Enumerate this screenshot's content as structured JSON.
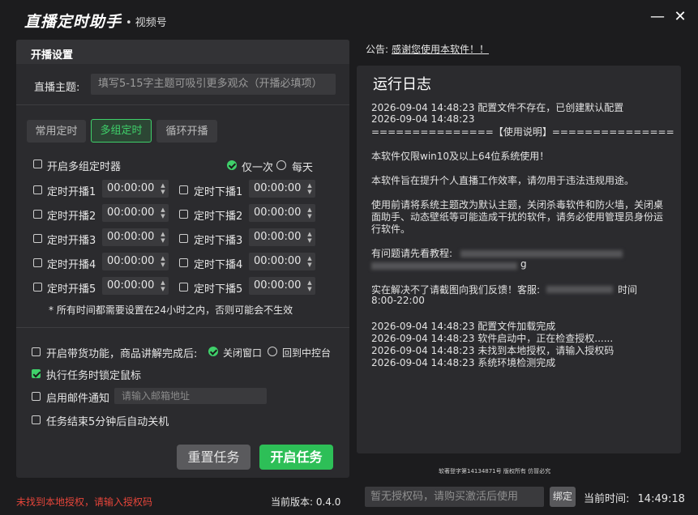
{
  "app": {
    "title": "直播定时助手",
    "subtitle": "• 视频号",
    "minimize_glyph": "—",
    "close_glyph": "✕"
  },
  "settings": {
    "header": "开播设置",
    "topic_label": "直播主题:",
    "topic_placeholder": "填写5-15字主题可吸引更多观众（开播必填项）",
    "tabs": [
      {
        "label": "常用定时",
        "active": false
      },
      {
        "label": "多组定时",
        "active": true
      },
      {
        "label": "循环开播",
        "active": false
      }
    ],
    "multi_timer_label": "开启多组定时器",
    "mode_once": "仅一次",
    "mode_daily": "每天",
    "timers": [
      {
        "start_label": "定时开播1",
        "start_time": "00:00:00",
        "stop_label": "定时下播1",
        "stop_time": "00:00:00"
      },
      {
        "start_label": "定时开播2",
        "start_time": "00:00:00",
        "stop_label": "定时下播2",
        "stop_time": "00:00:00"
      },
      {
        "start_label": "定时开播3",
        "start_time": "00:00:00",
        "stop_label": "定时下播3",
        "stop_time": "00:00:00"
      },
      {
        "start_label": "定时开播4",
        "start_time": "00:00:00",
        "stop_label": "定时下播4",
        "stop_time": "00:00:00"
      },
      {
        "start_label": "定时开播5",
        "start_time": "00:00:00",
        "stop_label": "定时下播5",
        "stop_time": "00:00:00"
      }
    ],
    "time_note": "* 所有时间都需要设置在24小时之内，否则可能会不生效",
    "goods_label": "开启带货功能，商品讲解完成后:",
    "close_window": "关闭窗口",
    "back_console": "回到中控台",
    "lock_mouse_label": "执行任务时锁定鼠标",
    "email_label": "启用邮件通知",
    "email_placeholder": "请输入邮箱地址",
    "shutdown_label": "任务结束5分钟后自动关机",
    "reset_button": "重置任务",
    "start_button": "开启任务"
  },
  "notice": {
    "prefix": "公告:",
    "text": "感谢您使用本软件！！"
  },
  "log": {
    "title": "运行日志",
    "lines": [
      "2026-09-04 14:48:23 配置文件不存在，已创建默认配置",
      "2026-09-04 14:48:23",
      "===============【使用说明】===============",
      "本软件仅限win10及以上64位系统使用！",
      "本软件旨在提升个人直播工作效率，请勿用于违法违规用途。",
      "使用前请将系统主题改为默认主题，关闭杀毒软件和防火墙，关闭桌",
      "面助手、动态壁纸等可能造成干扰的软件，请务必使用管理员身份运",
      "行软件。",
      "有问题请先看教程:",
      "g",
      "实在解决不了请截图向我们反馈！客服:",
      "时间",
      "8:00-22:00",
      "2026-09-04 14:48:23 配置文件加载完成",
      "2026-09-04 14:48:23 软件启动中，正在检查授权......",
      "2026-09-04 14:48:23 未找到本地授权，请输入授权码",
      "2026-09-04 14:48:23 系统环境检测完成"
    ]
  },
  "copyright": "软著登字第14134871号 版权所有 仿冒必究",
  "footer": {
    "license_warning": "未找到本地授权，请输入授权码",
    "version_label": "当前版本: 0.4.0",
    "code_placeholder": "暂无授权码，请购买激活后使用",
    "bind_button": "绑定",
    "time_label": "当前时间:",
    "time_value": "14:49:18"
  },
  "colors": {
    "accent": "#3fd06a",
    "warning": "#e5453a",
    "background": "#1c1c1e",
    "panel": "#2b2b2e"
  }
}
